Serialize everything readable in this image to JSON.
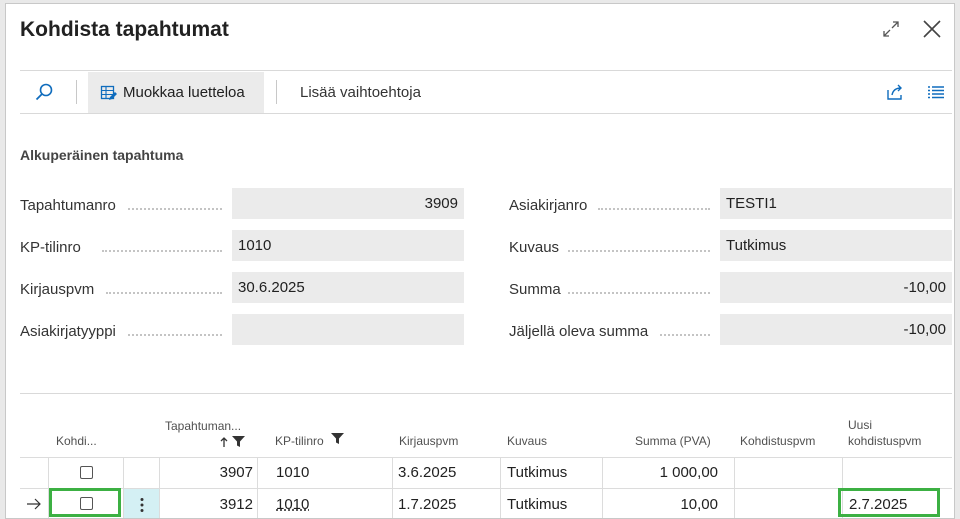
{
  "dialog": {
    "title": "Kohdista tapahtumat",
    "expand_icon": "expand-arrows-icon",
    "close_icon": "close-x-icon"
  },
  "toolbar": {
    "search_icon": "search-icon",
    "edit_list_label": "Muokkaa luetteloa",
    "edit_list_icon": "edit-list-icon",
    "more_options_label": "Lisää vaihtoehtoja",
    "share_icon": "share-icon",
    "list_view_icon": "list-view-icon"
  },
  "original_entry": {
    "section_title": "Alkuperäinen tapahtuma",
    "fields_left": [
      {
        "label": "Tapahtumanro",
        "value": "3909"
      },
      {
        "label": "KP-tilinro",
        "value": "1010"
      },
      {
        "label": "Kirjauspvm",
        "value": "30.6.2025"
      },
      {
        "label": "Asiakirjatyyppi",
        "value": ""
      }
    ],
    "fields_right": [
      {
        "label": "Asiakirjanro",
        "value": "TESTI1"
      },
      {
        "label": "Kuvaus",
        "value": "Tutkimus"
      },
      {
        "label": "Summa",
        "value": "-10,00"
      },
      {
        "label": "Jäljellä oleva summa",
        "value": "-10,00"
      }
    ]
  },
  "table": {
    "columns": {
      "apply": "Kohdi...",
      "entry_no": "Tapahtuman...",
      "gl_account": "KP-tilinro",
      "posting_date": "Kirjauspvm",
      "description": "Kuvaus",
      "amount": "Summa (PVA)",
      "application_date": "Kohdistuspvm",
      "new_application_date_line1": "Uusi",
      "new_application_date_line2": "kohdistuspvm"
    },
    "sort_icon": "sort-ascending-arrow-icon",
    "filter_icon": "filter-funnel-icon",
    "row_pointer_icon": "current-row-arrow-icon",
    "row_actions_icon": "vertical-ellipsis-icon",
    "rows": [
      {
        "apply": false,
        "entry_no": "3907",
        "gl_account": "1010",
        "posting_date": "3.6.2025",
        "description": "Tutkimus",
        "amount": "1 000,00",
        "application_date": "",
        "new_application_date": ""
      },
      {
        "apply": false,
        "entry_no": "3912",
        "gl_account": "1010",
        "posting_date": "1.7.2025",
        "description": "Tutkimus",
        "amount": "10,00",
        "application_date": "",
        "new_application_date": "2.7.2025"
      }
    ]
  },
  "colors": {
    "highlight": "#3cb043",
    "field_bg": "#ebebeb",
    "accent": "#0f6cbd",
    "selected_cell_bg": "#d4f0f4"
  }
}
